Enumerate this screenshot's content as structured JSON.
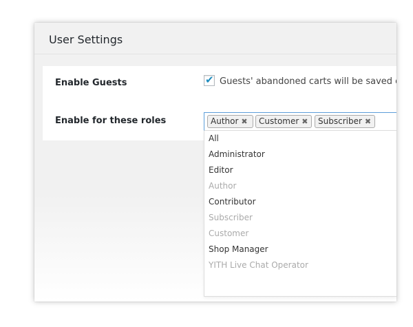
{
  "panel": {
    "title": "User Settings"
  },
  "settings": {
    "enable_guests_label": "Enable Guests",
    "enable_guests_checked": true,
    "enable_guests_description": "Guests' abandoned carts will be saved or",
    "roles_label": "Enable for these roles",
    "selected_roles": [
      "Author",
      "Customer",
      "Subscriber"
    ]
  },
  "dropdown": {
    "options": [
      {
        "label": "All",
        "disabled": false
      },
      {
        "label": "Administrator",
        "disabled": false
      },
      {
        "label": "Editor",
        "disabled": false
      },
      {
        "label": "Author",
        "disabled": true
      },
      {
        "label": "Contributor",
        "disabled": false
      },
      {
        "label": "Subscriber",
        "disabled": true
      },
      {
        "label": "Customer",
        "disabled": true
      },
      {
        "label": "Shop Manager",
        "disabled": false
      },
      {
        "label": "YITH Live Chat Operator",
        "disabled": true
      }
    ]
  },
  "colors": {
    "accent": "#1e8cbe",
    "focus_border": "#5b9dd9",
    "disabled_text": "#aaaaaa"
  },
  "icons": {
    "check": "checkmark-icon",
    "remove": "close-icon"
  }
}
